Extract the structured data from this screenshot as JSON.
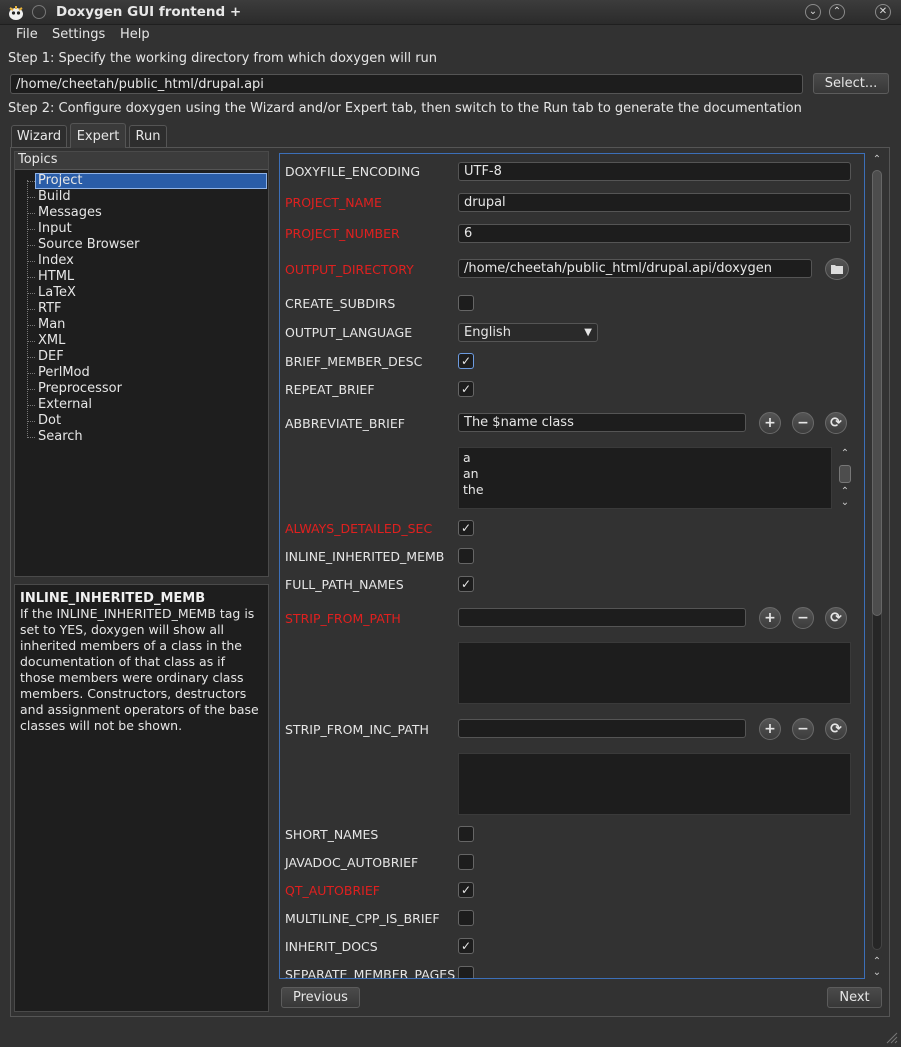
{
  "window": {
    "title": "Doxygen GUI frontend +"
  },
  "menu": [
    "File",
    "Settings",
    "Help"
  ],
  "step1": {
    "label": "Step 1: Specify the working directory from which doxygen will run",
    "directory": "/home/cheetah/public_html/drupal.api",
    "select_label": "Select..."
  },
  "step2": {
    "label": "Step 2: Configure doxygen using the Wizard and/or Expert tab, then switch to the Run tab to generate the documentation"
  },
  "tabs": [
    "Wizard",
    "Expert",
    "Run"
  ],
  "topics": {
    "header": "Topics",
    "items": [
      "Project",
      "Build",
      "Messages",
      "Input",
      "Source Browser",
      "Index",
      "HTML",
      "LaTeX",
      "RTF",
      "Man",
      "XML",
      "DEF",
      "PerlMod",
      "Preprocessor",
      "External",
      "Dot",
      "Search"
    ],
    "selected": "Project"
  },
  "help": {
    "title": "INLINE_INHERITED_MEMB",
    "lines": [
      "If the INLINE_INHERITED_MEMB tag is",
      "set to YES, doxygen will show all",
      "inherited members of a class in the",
      "documentation of that class as if",
      "those members were ordinary class",
      "members. Constructors, destructors",
      "and assignment operators of the base",
      "classes will not be shown."
    ]
  },
  "options": {
    "doxyfile_encoding": {
      "label": "DOXYFILE_ENCODING",
      "value": "UTF-8"
    },
    "project_name": {
      "label": "PROJECT_NAME",
      "value": "drupal"
    },
    "project_number": {
      "label": "PROJECT_NUMBER",
      "value": "6"
    },
    "output_directory": {
      "label": "OUTPUT_DIRECTORY",
      "value": "/home/cheetah/public_html/drupal.api/doxygen"
    },
    "create_subdirs": {
      "label": "CREATE_SUBDIRS",
      "checked": false
    },
    "output_language": {
      "label": "OUTPUT_LANGUAGE",
      "value": "English"
    },
    "brief_member_desc": {
      "label": "BRIEF_MEMBER_DESC",
      "checked": true
    },
    "repeat_brief": {
      "label": "REPEAT_BRIEF",
      "checked": true
    },
    "abbreviate_brief": {
      "label": "ABBREVIATE_BRIEF",
      "value": "The $name class",
      "list": [
        "a",
        "an",
        "the"
      ]
    },
    "always_detailed_sec": {
      "label": "ALWAYS_DETAILED_SEC",
      "checked": true
    },
    "inline_inherited_memb": {
      "label": "INLINE_INHERITED_MEMB",
      "checked": false
    },
    "full_path_names": {
      "label": "FULL_PATH_NAMES",
      "checked": true
    },
    "strip_from_path": {
      "label": "STRIP_FROM_PATH",
      "value": ""
    },
    "strip_from_inc_path": {
      "label": "STRIP_FROM_INC_PATH",
      "value": ""
    },
    "short_names": {
      "label": "SHORT_NAMES",
      "checked": false
    },
    "javadoc_autobrief": {
      "label": "JAVADOC_AUTOBRIEF",
      "checked": false
    },
    "qt_autobrief": {
      "label": "QT_AUTOBRIEF",
      "checked": true
    },
    "multiline_cpp_is_brief": {
      "label": "MULTILINE_CPP_IS_BRIEF",
      "checked": false
    },
    "inherit_docs": {
      "label": "INHERIT_DOCS",
      "checked": true
    },
    "separate_member_pages": {
      "label": "SEPARATE_MEMBER_PAGES",
      "checked": false
    }
  },
  "nav": {
    "previous": "Previous",
    "next": "Next"
  },
  "colors": {
    "modified_option": "#e0201f",
    "selection": "#2a5da8",
    "focus_border": "#3c6fb8"
  }
}
